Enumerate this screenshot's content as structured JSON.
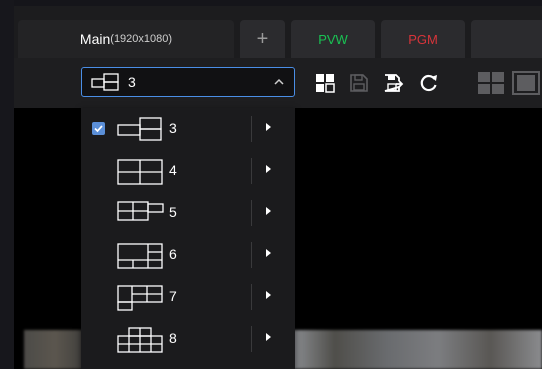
{
  "tabs": [
    {
      "label": "Main",
      "resolution": "(1920x1080)",
      "active": true
    },
    {
      "label": "+"
    },
    {
      "label": "PVW",
      "color": "#19c253"
    },
    {
      "label": "PGM",
      "color": "#d6343a"
    }
  ],
  "layout_selector": {
    "icon": "layout-3-icon",
    "value": "3",
    "expanded": true
  },
  "toolbar_icons": [
    "grid-icon",
    "save-icon",
    "save-as-icon",
    "refresh-icon",
    "layout-2x2-icon",
    "layout-monitor-icon"
  ],
  "layouts": [
    {
      "label": "3",
      "icon": "layout-3-icon",
      "selected": true
    },
    {
      "label": "4",
      "icon": "layout-4-icon",
      "selected": false
    },
    {
      "label": "5",
      "icon": "layout-5-icon",
      "selected": false
    },
    {
      "label": "6",
      "icon": "layout-6-icon",
      "selected": false
    },
    {
      "label": "7",
      "icon": "layout-7-icon",
      "selected": false
    },
    {
      "label": "8",
      "icon": "layout-8-icon",
      "selected": false
    }
  ],
  "colors": {
    "accent": "#4a8ee6",
    "pvw": "#19c253",
    "pgm": "#d6343a"
  }
}
